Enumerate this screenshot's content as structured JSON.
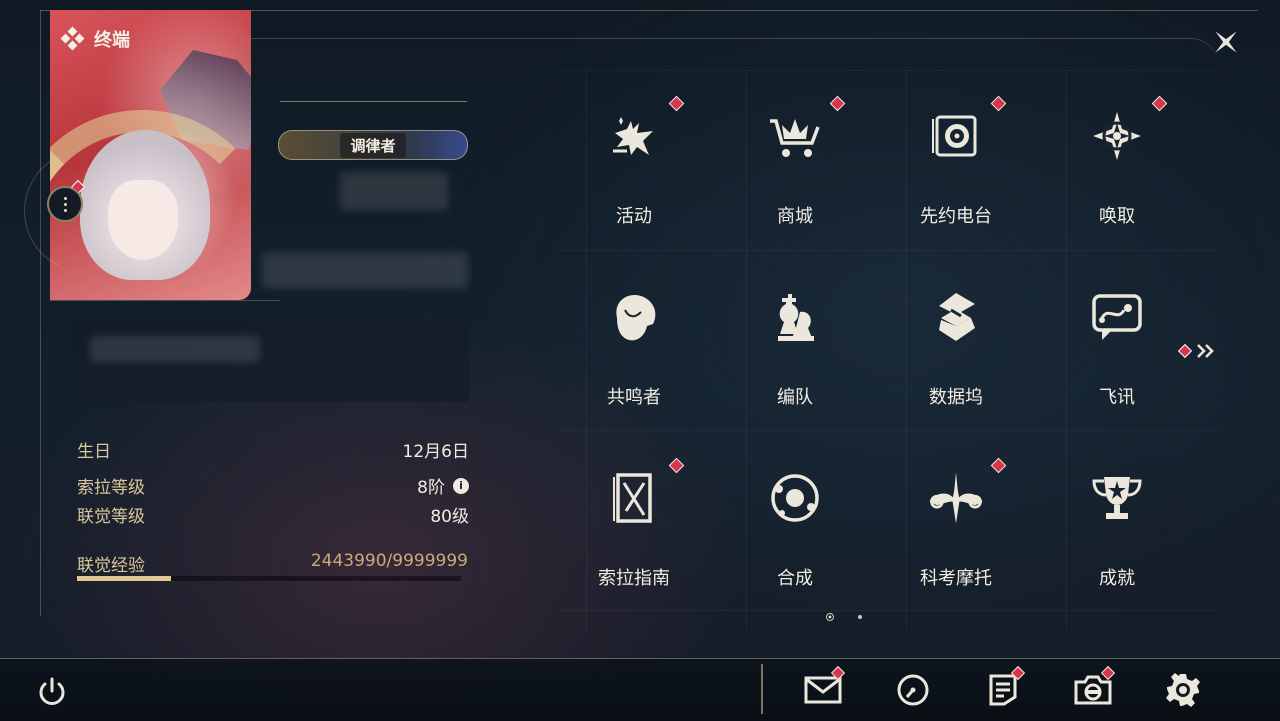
{
  "header": {
    "title": "终端"
  },
  "profile": {
    "title_badge": "调律者",
    "info": [
      {
        "label": "生日",
        "value": "12月6日"
      },
      {
        "label": "索拉等级",
        "value": "8阶"
      },
      {
        "label": "联觉等级",
        "value": "80级"
      }
    ],
    "exp": {
      "label": "联觉经验",
      "value": "2443990/9999999",
      "progress": 0.2444
    }
  },
  "grid": {
    "items": [
      {
        "label": "活动",
        "icon": "activity-icon",
        "badge": true
      },
      {
        "label": "商城",
        "icon": "shop-cart-icon",
        "badge": true
      },
      {
        "label": "先约电台",
        "icon": "radio-icon",
        "badge": true
      },
      {
        "label": "唤取",
        "icon": "compass-star-icon",
        "badge": true
      },
      {
        "label": "共鸣者",
        "icon": "character-head-icon",
        "badge": false
      },
      {
        "label": "编队",
        "icon": "chess-team-icon",
        "badge": false
      },
      {
        "label": "数据坞",
        "icon": "data-dock-icon",
        "badge": false
      },
      {
        "label": "飞讯",
        "icon": "message-icon",
        "badge": false
      },
      {
        "label": "索拉指南",
        "icon": "guidebook-icon",
        "badge": true
      },
      {
        "label": "合成",
        "icon": "synthesis-icon",
        "badge": false
      },
      {
        "label": "科考摩托",
        "icon": "motorcycle-icon",
        "badge": true
      },
      {
        "label": "成就",
        "icon": "trophy-icon",
        "badge": false
      }
    ],
    "page": 1,
    "page_count": 2
  },
  "bottom_bar": {
    "items": [
      {
        "name": "mail-icon",
        "badge": true
      },
      {
        "name": "clock-icon",
        "badge": false
      },
      {
        "name": "notes-icon",
        "badge": true
      },
      {
        "name": "camera-icon",
        "badge": true
      },
      {
        "name": "settings-gear-icon",
        "badge": false
      }
    ]
  },
  "colors": {
    "accent_gold": "#d9c79c",
    "badge_red": "#d4364b",
    "text": "#f2ede3"
  }
}
